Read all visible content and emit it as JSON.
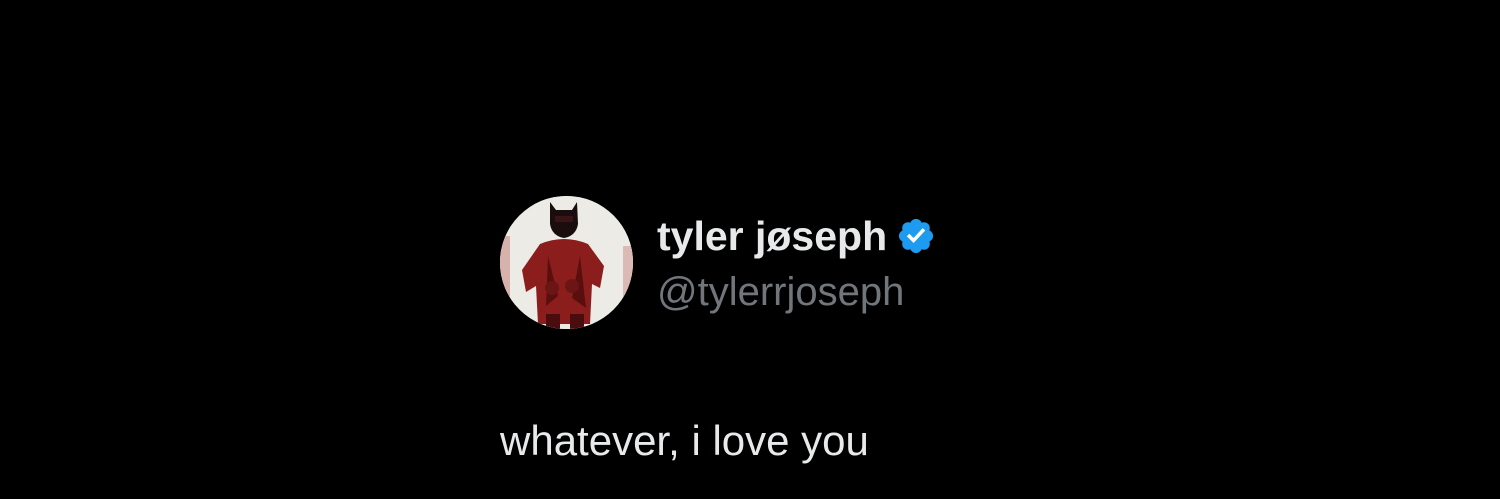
{
  "tweet": {
    "author": {
      "display_name": "tyler jøseph",
      "handle": "@tylerrjoseph",
      "verified": true,
      "verified_icon": "verified-badge-icon",
      "avatar": "profile-avatar"
    },
    "text": "whatever, i love you"
  },
  "colors": {
    "background": "#000000",
    "primary_text": "#e7e9ea",
    "secondary_text": "#71767b",
    "verified_blue": "#1d9bf0",
    "avatar_figure": "#8c1d1d"
  }
}
